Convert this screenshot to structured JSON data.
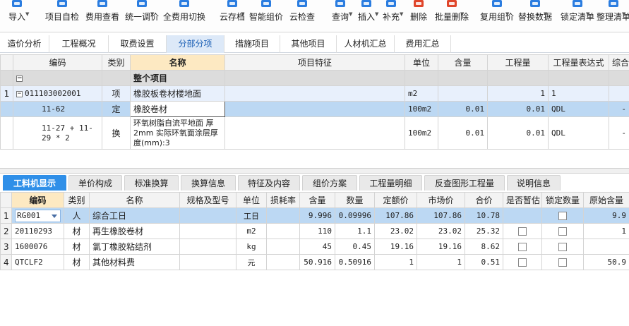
{
  "toolbar": {
    "items": [
      {
        "label": "导入",
        "icon": "import-icon",
        "color": "#2b7de0",
        "caret": true
      },
      {
        "label": "项目自检",
        "icon": "check-icon",
        "color": "#2b7de0"
      },
      {
        "label": "费用查看",
        "icon": "view-cost-icon",
        "color": "#2b7de0"
      },
      {
        "label": "统一调价",
        "icon": "adjust-price-icon",
        "color": "#2b7de0",
        "caret": true
      },
      {
        "label": "全费用切换",
        "icon": "switch-icon",
        "color": "#2b7de0"
      },
      {
        "label": "云存档",
        "icon": "cloud-save-icon",
        "color": "#2b7de0",
        "caret": true
      },
      {
        "label": "智能组价",
        "icon": "smart-price-icon",
        "color": "#2b7de0"
      },
      {
        "label": "云检查",
        "icon": "cloud-check-icon",
        "color": "#2b7de0"
      },
      {
        "label": "查询",
        "icon": "search-icon",
        "color": "#2b7de0",
        "caret": true
      },
      {
        "label": "插入",
        "icon": "insert-icon",
        "color": "#2b7de0",
        "caret": true
      },
      {
        "label": "补充",
        "icon": "supplement-icon",
        "color": "#2b7de0",
        "caret": true
      },
      {
        "label": "删除",
        "icon": "delete-icon",
        "color": "#e0462b"
      },
      {
        "label": "批量删除",
        "icon": "batch-delete-icon",
        "color": "#e0462b",
        "caret": true
      },
      {
        "label": "复用组价",
        "icon": "reuse-icon",
        "color": "#2b7de0",
        "caret": true
      },
      {
        "label": "替换数据",
        "icon": "replace-icon",
        "color": "#2b7de0",
        "caret": true
      },
      {
        "label": "锁定清单",
        "icon": "lock-icon",
        "color": "#2b7de0",
        "caret": true
      },
      {
        "label": "整理清单",
        "icon": "organize-icon",
        "color": "#2b7de0",
        "caret": true
      }
    ]
  },
  "top_tabs": [
    {
      "label": "造价分析"
    },
    {
      "label": "工程概况"
    },
    {
      "label": "取费设置"
    },
    {
      "label": "分部分项",
      "active": true
    },
    {
      "label": "措施项目"
    },
    {
      "label": "其他项目"
    },
    {
      "label": "人材机汇总"
    },
    {
      "label": "费用汇总"
    }
  ],
  "grid1": {
    "headers": [
      "编码",
      "类别",
      "名称",
      "项目特征",
      "单位",
      "含量",
      "工程量",
      "工程量表达式",
      "综合"
    ],
    "rows": [
      {
        "num": "",
        "code": "",
        "type": "",
        "name": "整个项目",
        "feature": "",
        "unit": "",
        "content": "",
        "qty": "",
        "expr": "",
        "extra": ""
      },
      {
        "num": "1",
        "code": "011103002001",
        "type": "项",
        "name": "橡胶板卷材楼地面",
        "feature": "",
        "unit": "m2",
        "content": "",
        "qty": "1",
        "expr": "1",
        "extra": ""
      },
      {
        "num": "",
        "code": "11-62",
        "type": "定",
        "name": "橡胶卷材",
        "feature": "",
        "unit": "100m2",
        "content": "0.01",
        "qty": "0.01",
        "expr": "QDL",
        "extra": "-"
      },
      {
        "num": "",
        "code": "11-27 + 11-29 * 2",
        "type": "换",
        "name": "环氧树脂自流平地面 厚2mm 实际环氧面涂层厚度(mm):3",
        "feature": "",
        "unit": "100m2",
        "content": "0.01",
        "qty": "0.01",
        "expr": "QDL",
        "extra": "-"
      }
    ]
  },
  "bottom_tabs": [
    {
      "label": "工料机显示",
      "active": true
    },
    {
      "label": "单价构成"
    },
    {
      "label": "标准换算"
    },
    {
      "label": "换算信息"
    },
    {
      "label": "特征及内容"
    },
    {
      "label": "组价方案"
    },
    {
      "label": "工程量明细"
    },
    {
      "label": "反查图形工程量"
    },
    {
      "label": "说明信息"
    }
  ],
  "grid2": {
    "headers": [
      "编码",
      "类别",
      "名称",
      "规格及型号",
      "单位",
      "损耗率",
      "含量",
      "数量",
      "定额价",
      "市场价",
      "合价",
      "是否暂估",
      "锁定数量",
      "原始含量"
    ],
    "rows": [
      {
        "num": "1",
        "code": "RG001",
        "type": "人",
        "name": "综合工日",
        "spec": "",
        "unit": "工日",
        "loss": "",
        "content": "9.996",
        "qty": "0.09996",
        "price": "107.86",
        "market": "107.86",
        "total": "10.78",
        "orig": "9.9"
      },
      {
        "num": "2",
        "code": "20110293",
        "type": "材",
        "name": "再生橡胶卷材",
        "spec": "",
        "unit": "m2",
        "loss": "",
        "content": "110",
        "qty": "1.1",
        "price": "23.02",
        "market": "23.02",
        "total": "25.32",
        "orig": "1"
      },
      {
        "num": "3",
        "code": "1600076",
        "type": "材",
        "name": "氯丁橡胶粘结剂",
        "spec": "",
        "unit": "kg",
        "loss": "",
        "content": "45",
        "qty": "0.45",
        "price": "19.16",
        "market": "19.16",
        "total": "8.62",
        "orig": ""
      },
      {
        "num": "4",
        "code": "QTCLF2",
        "type": "材",
        "name": "其他材料费",
        "spec": "",
        "unit": "元",
        "loss": "",
        "content": "50.916",
        "qty": "0.50916",
        "price": "1",
        "market": "1",
        "total": "0.51",
        "orig": "50.9"
      }
    ]
  }
}
